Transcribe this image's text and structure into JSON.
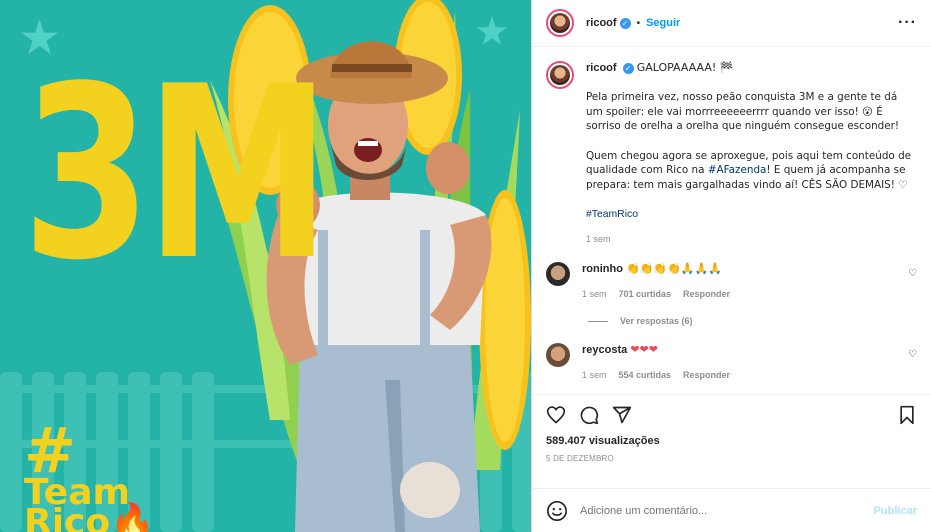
{
  "post": {
    "username": "ricoof",
    "follow_label": "Seguir",
    "dot": "•",
    "more_icon": "more-horizontal-icon",
    "verified_glyph": "✓"
  },
  "media": {
    "big_text": "3M",
    "team_hash": "#",
    "team_line1": "Team",
    "team_line2": "Rico🔥",
    "colors": {
      "background": "#23b3a7",
      "yellow": "#f2d21f"
    }
  },
  "caption": {
    "username": "ricoof",
    "headline": "GALOPAAAAA! 🏁",
    "para1": "Pela primeira vez, nosso peão conquista 3M e a gente te dá um spoiler: ele vai morrreeeeeerrrr quando ver isso! 😮 É sorriso de orelha a orelha que ninguém consegue esconder!",
    "para2_a": "Quem chegou agora se aproxegue, pois aqui tem conteúdo de qualidade com Rico na ",
    "para2_link": "#AFazenda",
    "para2_b": "! E quem já acompanha se prepara: tem mais gargalhadas vindo aí! CÊS SÃO DEMAIS! ♡",
    "hashtag": "#TeamRico",
    "time": "1 sem"
  },
  "comments": [
    {
      "username": "roninho",
      "text": "👏👏👏👏🙏🙏🙏",
      "time": "1 sem",
      "likes": "701 curtidas",
      "reply": "Responder",
      "view_replies": "Ver respostas (6)"
    },
    {
      "username": "reycosta",
      "text": "❤❤❤",
      "time": "1 sem",
      "likes": "554 curtidas",
      "reply": "Responder"
    }
  ],
  "stats": {
    "views": "589.407 visualizações",
    "date": "5 DE DEZEMBRO"
  },
  "add_comment": {
    "placeholder": "Adicione um comentário...",
    "publish": "Publicar"
  },
  "colors": {
    "link": "#0095f6",
    "muted": "#8e8e8e",
    "verified": "#3897f0"
  }
}
